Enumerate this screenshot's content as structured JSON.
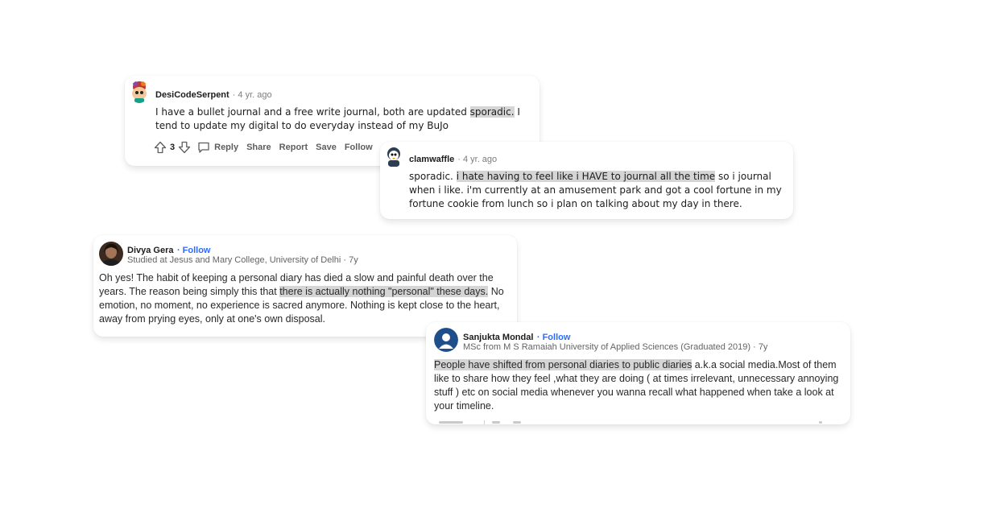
{
  "comment1": {
    "username": "DesiCodeSerpent",
    "time": "· 4 yr. ago",
    "text_before": "I have a bullet journal and a free write journal, both are updated ",
    "text_highlight": "sporadic.",
    "text_after": " I tend to update my digital to do everyday instead of my BuJo",
    "vote_count": "3",
    "actions": {
      "reply": "Reply",
      "share": "Share",
      "report": "Report",
      "save": "Save",
      "follow": "Follow"
    }
  },
  "comment2": {
    "username": "clamwaffle",
    "time": "· 4 yr. ago",
    "text_before": "sporadic. ",
    "text_highlight": "i hate having to feel like i HAVE to journal all the time",
    "text_after": " so i journal when i like. i'm currently at an amusement park and got a cool fortune in my fortune cookie from lunch so i plan on talking about my day in there."
  },
  "answer1": {
    "name": "Divya Gera",
    "follow": "· Follow",
    "credential": "Studied at Jesus and Mary College, University of Delhi · 7y",
    "text_before": "Oh yes! The habit of keeping a personal diary has died a slow and painful death over the years. The reason being simply this that ",
    "text_highlight": "there is actually nothing \"personal\" these days.",
    "text_after": " No emotion, no moment, no experience is sacred anymore. Nothing is kept close to the heart, away from prying eyes, only at one's own disposal."
  },
  "answer2": {
    "name": "Sanjukta Mondal",
    "follow": "· Follow",
    "credential": "MSc from M S Ramaiah University of Applied Sciences (Graduated 2019) · 7y",
    "text_highlight": "People have shifted from personal diaries to public diaries",
    "text_after": " a.k.a social media.Most of them like to share how they feel ,what they are doing ( at times irrelevant, unnecessary annoying stuff ) etc on social media whenever you wanna recall what happened when take a look at your timeline."
  },
  "colors": {
    "highlight": "#d5d5d5",
    "quora_link": "#2e69ff"
  }
}
